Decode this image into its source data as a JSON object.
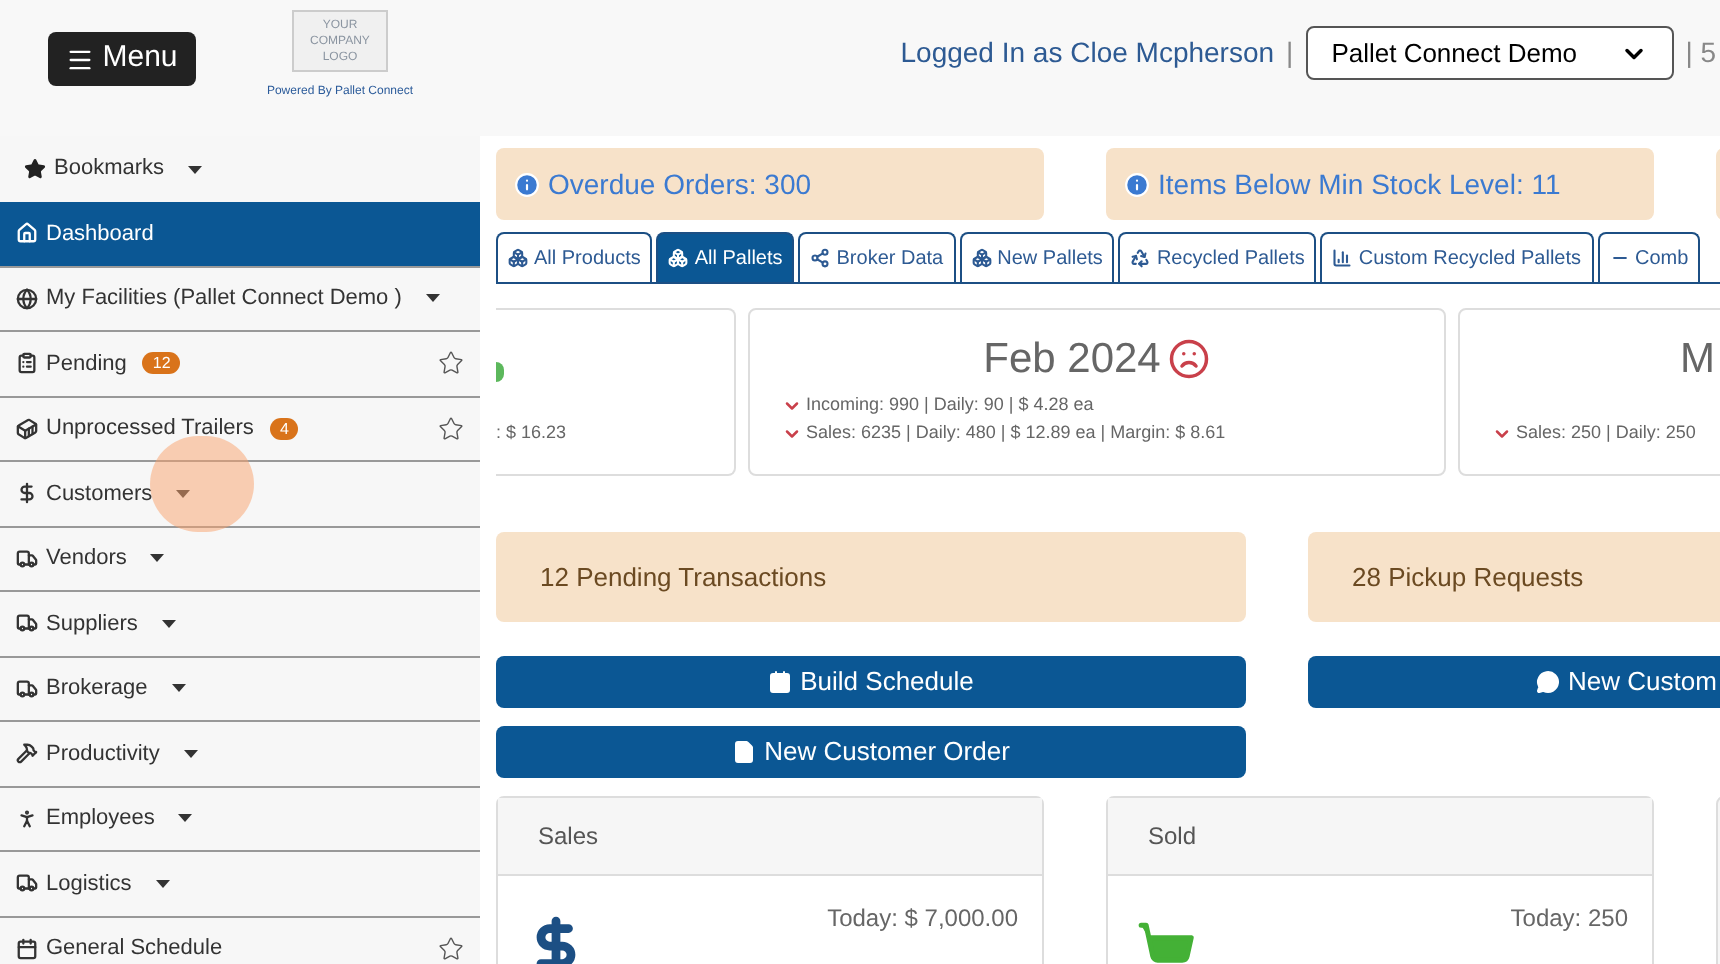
{
  "header": {
    "menu_button": "Menu",
    "logo_lines": [
      "YOUR",
      "COMPANY",
      "LOGO"
    ],
    "powered_by": "Powered By Pallet Connect",
    "logged_in": "Logged In as Cloe Mcpherson",
    "separator": "|",
    "facility_select": "Pallet Connect Demo",
    "trailing": "| 5"
  },
  "sidebar": {
    "bookmarks": "Bookmarks",
    "items": [
      {
        "label": "Dashboard",
        "selected": true,
        "dropdown": false,
        "star": false
      },
      {
        "label": "My Facilities (Pallet Connect Demo )",
        "selected": false,
        "dropdown": true,
        "star": false
      },
      {
        "label": "Pending",
        "badge": "12",
        "selected": false,
        "dropdown": false,
        "star": true
      },
      {
        "label": "Unprocessed Trailers",
        "badge": "4",
        "selected": false,
        "dropdown": false,
        "star": true
      },
      {
        "label": "Customers",
        "selected": false,
        "dropdown": true,
        "star": false
      },
      {
        "label": "Vendors",
        "selected": false,
        "dropdown": true,
        "star": false
      },
      {
        "label": "Suppliers",
        "selected": false,
        "dropdown": true,
        "star": false
      },
      {
        "label": "Brokerage",
        "selected": false,
        "dropdown": true,
        "star": false
      },
      {
        "label": "Productivity",
        "selected": false,
        "dropdown": true,
        "star": false
      },
      {
        "label": "Employees",
        "selected": false,
        "dropdown": true,
        "star": false
      },
      {
        "label": "Logistics",
        "selected": false,
        "dropdown": true,
        "star": false
      },
      {
        "label": "General Schedule",
        "selected": false,
        "dropdown": false,
        "star": true
      }
    ]
  },
  "alerts": [
    "Overdue Orders: 300",
    "Items Below Min Stock Level: 11"
  ],
  "tabs": [
    {
      "label": "All Products",
      "selected": false
    },
    {
      "label": "All Pallets",
      "selected": true
    },
    {
      "label": "Broker Data",
      "selected": false
    },
    {
      "label": "New Pallets",
      "selected": false
    },
    {
      "label": "Recycled Pallets",
      "selected": false
    },
    {
      "label": "Custom Recycled Pallets",
      "selected": false
    },
    {
      "label": "Comb",
      "selected": false
    }
  ],
  "stat_cards": [
    {
      "lines": [
        {
          "text": ": $ 16.23"
        }
      ]
    },
    {
      "title": "Feb 2024",
      "frowning": true,
      "lines": [
        {
          "text": "Incoming: 990 | Daily: 90 | $ 4.28 ea",
          "decreasing": true
        },
        {
          "text": "Sales: 6235 | Daily: 480 | $ 12.89 ea | Margin: $ 8.61",
          "decreasing": true
        }
      ]
    },
    {
      "title": "M",
      "lines": [
        {
          "text": "Sales: 250 | Daily: 250",
          "decreasing": true
        }
      ]
    }
  ],
  "summaries": [
    "12 Pending Transactions",
    "28 Pickup Requests"
  ],
  "buttons": [
    [
      "Build Schedule",
      "New Customer Order"
    ],
    [
      "New Custom"
    ]
  ],
  "panels": [
    {
      "title": "Sales",
      "today": "Today: $ 7,000.00"
    },
    {
      "title": "Sold",
      "today": "Today: 250"
    }
  ]
}
